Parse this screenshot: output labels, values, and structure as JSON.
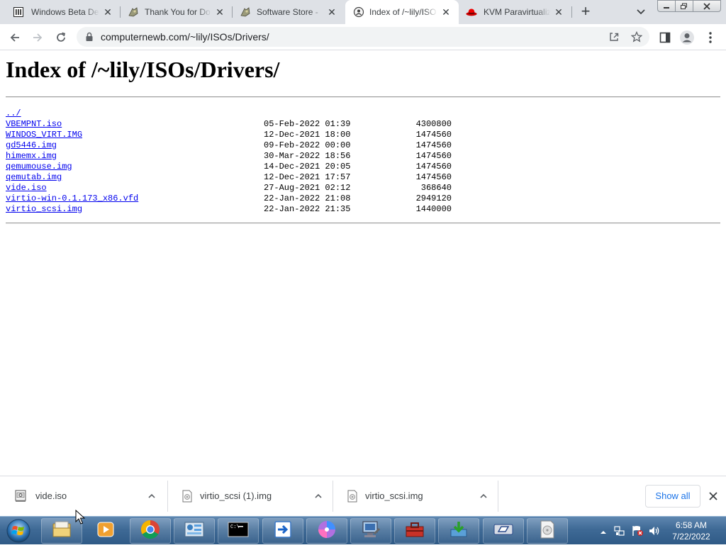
{
  "browser": {
    "tabs": [
      {
        "title": "Windows Beta De",
        "icon": "striped-box-icon"
      },
      {
        "title": "Thank You for Do",
        "icon": "software-store-icon"
      },
      {
        "title": "Software Store - ",
        "icon": "software-store-icon"
      },
      {
        "title": "Index of /~lily/ISO",
        "icon": "globe-person-icon",
        "active": true
      },
      {
        "title": "KVM Paravirtualiz",
        "icon": "red-hat-icon"
      }
    ],
    "url": "computernewb.com/~lily/ISOs/Drivers/"
  },
  "page": {
    "heading": "Index of /~lily/ISOs/Drivers/",
    "parent_link": "../",
    "files": [
      {
        "name": "VBEMPNT.iso",
        "date": "05-Feb-2022 01:39",
        "size": "4300800"
      },
      {
        "name": "WINDOS_VIRT.IMG",
        "date": "12-Dec-2021 18:00",
        "size": "1474560"
      },
      {
        "name": "gd5446.img",
        "date": "09-Feb-2022 00:00",
        "size": "1474560"
      },
      {
        "name": "himemx.img",
        "date": "30-Mar-2022 18:56",
        "size": "1474560"
      },
      {
        "name": "qemumouse.img",
        "date": "14-Dec-2021 20:05",
        "size": "1474560"
      },
      {
        "name": "qemutab.img",
        "date": "12-Dec-2021 17:57",
        "size": "1474560"
      },
      {
        "name": "vide.iso",
        "date": "27-Aug-2021 02:12",
        "size": "368640"
      },
      {
        "name": "virtio-win-0.1.173_x86.vfd",
        "date": "22-Jan-2022 21:08",
        "size": "2949120"
      },
      {
        "name": "virtio_scsi.img",
        "date": "22-Jan-2022 21:35",
        "size": "1440000"
      }
    ]
  },
  "downloads": {
    "items": [
      {
        "name": "vide.iso",
        "icon": "iso-file-icon"
      },
      {
        "name": "virtio_scsi (1).img",
        "icon": "disk-image-file-icon"
      },
      {
        "name": "virtio_scsi.img",
        "icon": "disk-image-file-icon"
      }
    ],
    "show_all": "Show all"
  },
  "taskbar": {
    "time": "6:58 AM",
    "date": "7/22/2022"
  },
  "colors": {
    "link": "#0000ee",
    "accent": "#1a73e8",
    "tab_strip": "#dee1e6",
    "taskbar": "#3f6a96"
  }
}
